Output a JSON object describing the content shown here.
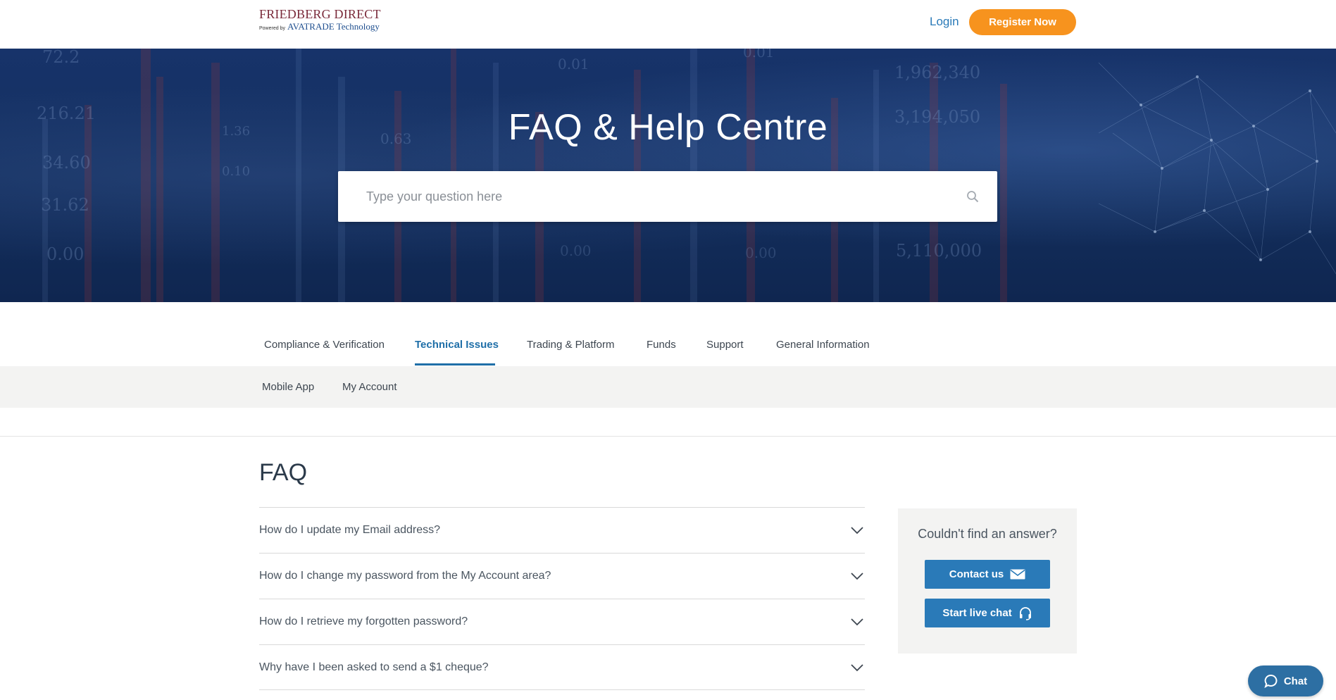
{
  "header": {
    "logo_main": "FRIEDBERG DIRECT",
    "logo_powered": "Powered by",
    "logo_sub": "AVATRADE Technology",
    "login_label": "Login",
    "register_label": "Register Now"
  },
  "hero": {
    "title": "FAQ & Help Centre",
    "search_placeholder": "Type your question here",
    "bg_numbers": [
      "72.2",
      "216.21",
      "34.60",
      "31.62",
      "0.00",
      "0.01",
      "0.01",
      "1,962,340",
      "3,194,050",
      "5,110,000",
      "0.00",
      "0.00",
      "0.63",
      "1.36",
      "0.10"
    ]
  },
  "tabs": [
    {
      "label": "Compliance & Verification",
      "active": false
    },
    {
      "label": "Technical Issues",
      "active": true
    },
    {
      "label": "Trading & Platform",
      "active": false
    },
    {
      "label": "Funds",
      "active": false
    },
    {
      "label": "Support",
      "active": false
    },
    {
      "label": "General Information",
      "active": false
    }
  ],
  "subtabs": [
    {
      "label": "Mobile App"
    },
    {
      "label": "My Account"
    }
  ],
  "faq": {
    "heading": "FAQ",
    "questions": [
      "How do I update my Email address?",
      "How do I change my password from the My Account area?",
      "How do I retrieve my forgotten password?",
      "Why have I been asked to send a $1 cheque?"
    ]
  },
  "help_box": {
    "title": "Couldn't find an answer?",
    "contact_label": "Contact us",
    "livechat_label": "Start live chat"
  },
  "chat_widget": {
    "label": "Chat"
  },
  "colors": {
    "brand_blue": "#2a7ab8",
    "accent_orange": "#f7931e",
    "hero_navy": "#14305f",
    "active_tab": "#1f6fa8"
  }
}
